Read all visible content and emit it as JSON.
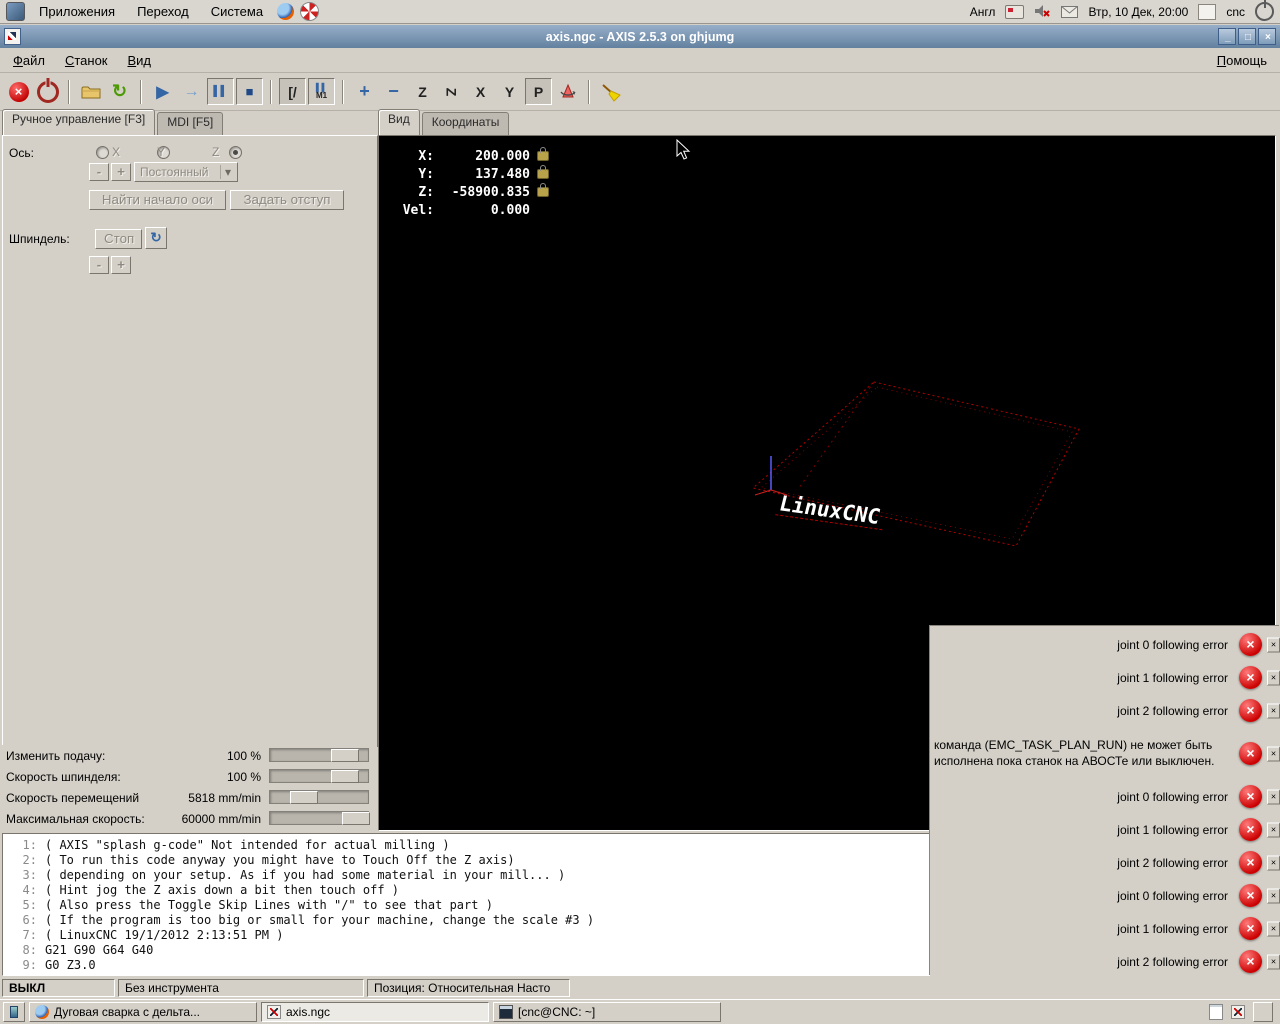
{
  "colors": {
    "titlebar_blue": "#62819f",
    "window_bg": "#d4d0c8",
    "error_red": "#cc0000",
    "toolpath_red": "#b40000",
    "preview_bg": "#000000",
    "accent_blue": "#3465a4"
  },
  "desktop": {
    "panel": {
      "menus": [
        "Приложения",
        "Переход",
        "Система"
      ],
      "layout_indicator": "Англ",
      "clock": "Втр, 10 Дек, 20:00",
      "user": "cnc"
    },
    "taskbar": {
      "windows": [
        {
          "label": "Дуговая сварка с дельта..."
        },
        {
          "label": "axis.ngc"
        },
        {
          "label": "[cnc@CNC: ~]"
        }
      ]
    }
  },
  "window": {
    "title": "axis.ngc - AXIS 2.5.3 on ghjumg",
    "menus": [
      "Файл",
      "Станок",
      "Вид"
    ],
    "help": "Помощь"
  },
  "icons": {
    "x": "×",
    "min": "_",
    "max": "□",
    "reload": "↻",
    "run": "▶",
    "step": "→",
    "pause": "▌▌",
    "stop": "■",
    "skip": "[/",
    "m1": "M1",
    "zoom_in": "+",
    "zoom_out": "−",
    "view_z": "Z",
    "view_z_rot": "Z",
    "view_x": "X",
    "view_y": "Y",
    "view_p": "P",
    "spindle_dir": "↻",
    "dropdown": "▾"
  },
  "manual": {
    "tab_manual": "Ручное управление [F3]",
    "tab_mdi": "MDI [F5]",
    "axis_label": "Ось:",
    "axis_x": "X",
    "axis_y": "Y",
    "axis_z": "Z",
    "minus": "-",
    "plus": "+",
    "jog_mode": "Постоянный",
    "home_button": "Найти начало оси",
    "offset_button": "Задать отступ",
    "spindle_label": "Шпиндель:",
    "spindle_stop": "Стоп"
  },
  "preview": {
    "tab_view": "Вид",
    "tab_coords": "Координаты",
    "readout": {
      "x_label": "X:",
      "x_value": "200.000",
      "y_label": "Y:",
      "y_value": "137.480",
      "z_label": "Z:",
      "z_value": "-58900.835",
      "vel_label": "Vel:",
      "vel_value": "0.000"
    },
    "logo": "LinuxCNC"
  },
  "overrides": {
    "feed_label": "Изменить подачу:",
    "feed_value": "100 %",
    "spindle_label": "Скорость шпинделя:",
    "spindle_value": "100 %",
    "jog_label": "Скорость перемещений",
    "jog_value": "5818 mm/min",
    "maxvel_label": "Максимальная скорость:",
    "maxvel_value": "60000 mm/min"
  },
  "gcode": {
    "lines": [
      {
        "n": "1:",
        "t": "( AXIS \"splash g-code\" Not intended for actual milling )"
      },
      {
        "n": "2:",
        "t": "( To run this code anyway you might have to Touch Off the Z axis)"
      },
      {
        "n": "3:",
        "t": "( depending on your setup. As if you had some material in your mill... )"
      },
      {
        "n": "4:",
        "t": "( Hint jog the Z axis down a bit then touch off )"
      },
      {
        "n": "5:",
        "t": "( Also press the Toggle Skip Lines with \"/\" to see that part )"
      },
      {
        "n": "6:",
        "t": "( If the program is too big or small for your machine, change the scale #3 )"
      },
      {
        "n": "7:",
        "t": "( LinuxCNC 19/1/2012 2:13:51 PM )"
      },
      {
        "n": "8:",
        "t": "G21 G90 G64 G40"
      },
      {
        "n": "9:",
        "t": "G0 Z3.0"
      }
    ]
  },
  "status": {
    "machine": "ВЫКЛ",
    "tool": "Без инструмента",
    "position": "Позиция: Относительная Насто"
  },
  "notifications": [
    "joint 0 following error",
    "joint 1 following error",
    "joint 2 following error",
    "команда (EMC_TASK_PLAN_RUN) не может быть исполнена пока станок на АВОСТе или выключен.",
    "joint 0 following error",
    "joint 1 following error",
    "joint 2 following error",
    "joint 0 following error",
    "joint 1 following error",
    "joint 2 following error"
  ]
}
